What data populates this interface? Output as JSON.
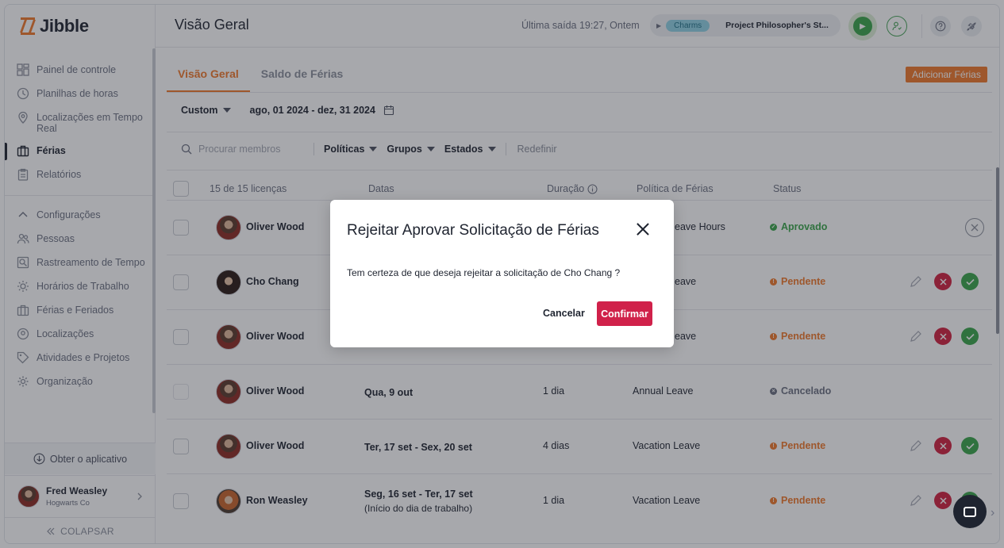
{
  "app": {
    "name": "Jibble"
  },
  "sidebar": {
    "items": [
      {
        "label": "Painel de controle",
        "icon": "dashboard-icon"
      },
      {
        "label": "Planilhas de horas",
        "icon": "clock-icon"
      },
      {
        "label": "Localizações em Tempo Real",
        "icon": "location-pin-icon"
      },
      {
        "label": "Férias",
        "icon": "briefcase-icon",
        "active": true
      },
      {
        "label": "Relatórios",
        "icon": "clipboard-icon"
      }
    ],
    "settings": [
      {
        "label": "Configurações",
        "icon": "chevron-up-icon"
      },
      {
        "label": "Pessoas",
        "icon": "people-icon"
      },
      {
        "label": "Rastreamento de Tempo",
        "icon": "time-tracking-icon"
      },
      {
        "label": "Horários de Trabalho",
        "icon": "sun-icon"
      },
      {
        "label": "Férias e Feriados",
        "icon": "briefcase-icon"
      },
      {
        "label": "Localizações",
        "icon": "location-pin-icon"
      },
      {
        "label": "Atividades e Projetos",
        "icon": "tag-icon"
      },
      {
        "label": "Organização",
        "icon": "gear-icon"
      }
    ],
    "get_app": "Obter o aplicativo",
    "user": {
      "name": "Fred Weasley",
      "org": "Hogwarts Co"
    },
    "collapse": "COLAPSAR"
  },
  "header": {
    "title": "Visão Geral",
    "last_out": "Última saída 19:27, Ontem",
    "timer_tag": "Charms",
    "timer_project": "Project Philosopher's St..."
  },
  "tabs": [
    {
      "label": "Visão Geral",
      "active": true
    },
    {
      "label": "Saldo de Férias",
      "active": false
    }
  ],
  "add_button": "Adicionar Férias",
  "filters": {
    "period": "Custom",
    "range": "ago, 01 2024 - dez, 31 2024",
    "search_placeholder": "Procurar membros",
    "policies": "Políticas",
    "groups": "Grupos",
    "states": "Estados",
    "reset": "Redefinir"
  },
  "table": {
    "count": "15 de 15 licenças",
    "columns": {
      "dates": "Datas",
      "duration": "Duração",
      "policy": "Política de Férias",
      "status": "Status"
    },
    "rows": [
      {
        "name": "Oliver Wood",
        "dates": "",
        "dates_sub": "",
        "duration": "",
        "policy": "eave Hours",
        "status": "Aprovado",
        "kind": "ok"
      },
      {
        "name": "Cho Chang",
        "dates": "",
        "dates_sub": "",
        "duration": "",
        "policy": "eave",
        "status": "Pendente",
        "kind": "pend"
      },
      {
        "name": "Oliver Wood",
        "dates": "",
        "dates_sub": "",
        "duration": "",
        "policy": "eave",
        "status": "Pendente",
        "kind": "pend"
      },
      {
        "name": "Oliver Wood",
        "dates": "Qua, 9 out",
        "dates_sub": "",
        "duration": "1 dia",
        "policy": "Annual Leave",
        "status": "Cancelado",
        "kind": "cancel"
      },
      {
        "name": "Oliver Wood",
        "dates": "Ter, 17 set - Sex, 20 set",
        "dates_sub": "",
        "duration": "4 dias",
        "policy": "Vacation Leave",
        "status": "Pendente",
        "kind": "pend"
      },
      {
        "name": "Ron Weasley",
        "dates": "Seg, 16 set - Ter, 17 set",
        "dates_sub": "(Início do dia de trabalho)",
        "duration": "1 dia",
        "policy": "Vacation Leave",
        "status": "Pendente",
        "kind": "pend"
      }
    ]
  },
  "modal": {
    "title": "Rejeitar Aprovar Solicitação de Férias",
    "message": "Tem certeza de que deseja rejeitar a solicitação de Cho Chang ?",
    "cancel": "Cancelar",
    "confirm": "Confirmar"
  },
  "colors": {
    "accent": "#f0782a",
    "approve": "#3aa64a",
    "reject": "#d0213f"
  }
}
